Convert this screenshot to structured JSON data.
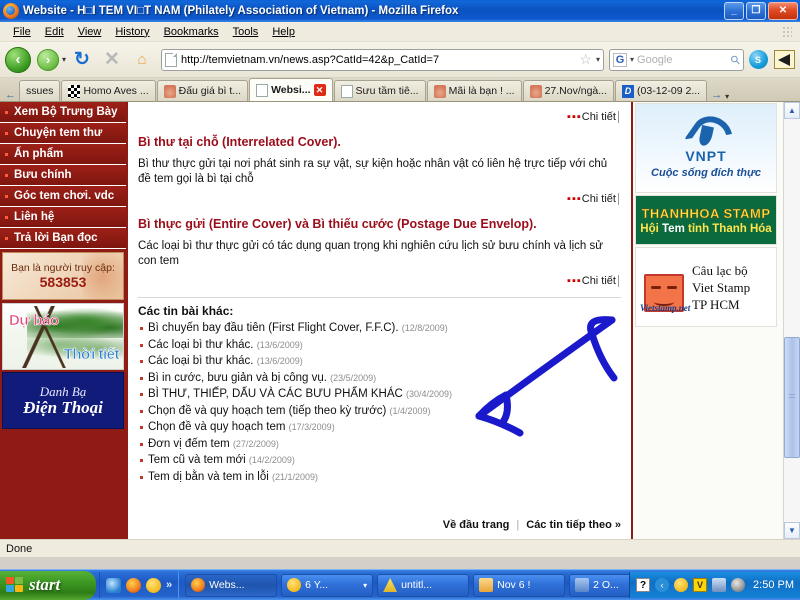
{
  "window": {
    "title": "Website - H□I TEM VI□T NAM (Philately Association of Vietnam) - Mozilla Firefox",
    "minimize_label": "_",
    "maximize_label": "❐",
    "close_label": "✕"
  },
  "menubar": {
    "items": [
      "File",
      "Edit",
      "View",
      "History",
      "Bookmarks",
      "Tools",
      "Help"
    ]
  },
  "toolbar": {
    "back_icon": "‹",
    "forward_icon": "›",
    "dropdown_icon": "▾",
    "reload_icon": "↻",
    "stop_icon": "✕",
    "home_icon": "⌂",
    "url": "http://temvietnam.vn/news.asp?CatId=42&p_CatId=7",
    "bookmark_star_icon": "☆",
    "url_dropdown_icon": "▾",
    "search_engine_letter": "G",
    "search_placeholder": "Google",
    "search_value": "",
    "magnifier_icon": "⚲",
    "skype_label": "S",
    "megaphone_icon": "megaphone"
  },
  "tabs": {
    "left_scroll_icon": "←",
    "right_scroll_icon": "→",
    "list_dropdown_icon": "▾",
    "items": [
      {
        "label": "ssues",
        "icon": "none",
        "active": false
      },
      {
        "label": "Homo Aves ...",
        "icon": "checker",
        "active": false
      },
      {
        "label": "Đấu giá bì t...",
        "icon": "house",
        "active": false
      },
      {
        "label": "Websi...",
        "icon": "doc",
        "active": true,
        "close_label": "✕"
      },
      {
        "label": "Sưu tầm tiê...",
        "icon": "doc",
        "active": false
      },
      {
        "label": "Mãi là bạn ! ...",
        "icon": "house",
        "active": false
      },
      {
        "label": "27.Nov/ngà...",
        "icon": "house",
        "active": false
      },
      {
        "label": "(03-12-09 2...",
        "icon": "dblue",
        "active": false
      }
    ]
  },
  "sidebar": {
    "items": [
      "Xem Bộ Trưng Bày",
      "Chuyện tem thư",
      "Ấn phẩm",
      "Bưu chính",
      "Góc tem chơi. vdc",
      "Liên hệ",
      "Trả lời Bạn đọc"
    ],
    "counter": {
      "label": "Bạn là người truy cập:",
      "value": "583853"
    },
    "banners": [
      {
        "name": "weather",
        "line1": "Dự báo",
        "line2": "Thời tiết"
      },
      {
        "name": "phone-directory",
        "line1": "Danh Bạ",
        "line2": "Điện Thoại"
      }
    ]
  },
  "main": {
    "detail_link_label": "Chi tiết",
    "detail_dots": "▪▪▪",
    "articles": [
      {
        "title": "Bì thư tại chỗ (Interrelated Cover).",
        "body": "Bì thư thực gửi tại nơi phát sinh ra sự vật, sự kiện hoặc nhân vật có liên hệ trực tiếp với chủ đề tem gọi là bì tại chỗ"
      },
      {
        "title": "Bì thực gửi (Entire Cover) và Bì thiếu cước (Postage Due Envelop).",
        "body": "Các loại bì thư thực gửi có tác dụng quan trọng khi nghiên cứu lịch sử bưu chính và lịch sử con tem"
      }
    ],
    "other_news_heading": "Các tin bài khác:",
    "news_items": [
      {
        "title": "Bì chuyến bay đầu tiên (First Flight Cover, F.F.C).",
        "date": "(12/8/2009)"
      },
      {
        "title": "Các loại bì thư khác.",
        "date": "(13/6/2009)"
      },
      {
        "title": "Các loại bì thư khác.",
        "date": "(13/6/2009)"
      },
      {
        "title": "Bì in cước, bưu giản và bị công vụ.",
        "date": "(23/5/2009)"
      },
      {
        "title": "BÌ THƯ, THIẾP, DẤU VÀ CÁC BƯU PHẨM KHÁC",
        "date": "(30/4/2009)"
      },
      {
        "title": "Chọn đề và quy hoạch tem (tiếp theo kỳ trước)",
        "date": "(1/4/2009)"
      },
      {
        "title": "Chọn đề và quy hoạch tem",
        "date": "(17/3/2009)"
      },
      {
        "title": "Đơn vị đếm tem",
        "date": "(27/2/2009)"
      },
      {
        "title": "Tem cũ và tem mới",
        "date": "(14/2/2009)"
      },
      {
        "title": "Tem dị bằn và tem in lỗi",
        "date": "(21/1/2009)"
      }
    ],
    "bottom_links": {
      "top_label": "Về đầu trang",
      "divider": "|",
      "next_label": "Các tin tiếp theo »"
    }
  },
  "ads": [
    {
      "name": "vnpt",
      "brand": "VNPT",
      "slogan": "Cuộc sống đích thực"
    },
    {
      "name": "thanhhoa-stamp",
      "line1": "THANHHOA STAMP",
      "line2_a": "Hội ",
      "line2_b": "Tem ",
      "line2_c": "tỉnh Thanh Hóa"
    },
    {
      "name": "viet-stamp",
      "line1": "Câu lạc bộ",
      "line2": "Viet Stamp",
      "line3": "TP HCM",
      "url_text": "Vietstamp.net"
    }
  ],
  "scrollbar": {
    "up_icon": "▲",
    "down_icon": "▼"
  },
  "statusbar": {
    "text": "Done"
  },
  "taskbar": {
    "start_label": "start",
    "quicklaunch_more_icon": "»",
    "tasks": [
      {
        "label": "Webs...",
        "icon": "ff",
        "selected": true,
        "dropdown": ""
      },
      {
        "label": "6 Y...",
        "icon": "ym",
        "selected": false,
        "dropdown": "▾"
      },
      {
        "label": "untitl...",
        "icon": "pen",
        "selected": false,
        "dropdown": ""
      },
      {
        "label": "Nov 6 !",
        "icon": "fold",
        "selected": false,
        "dropdown": ""
      },
      {
        "label": "2 O...",
        "icon": "ppt",
        "selected": false,
        "dropdown": "▾"
      }
    ],
    "tray": {
      "help_label": "?",
      "arrow_label": "‹",
      "v_label": "V"
    },
    "clock": "2:50 PM"
  }
}
